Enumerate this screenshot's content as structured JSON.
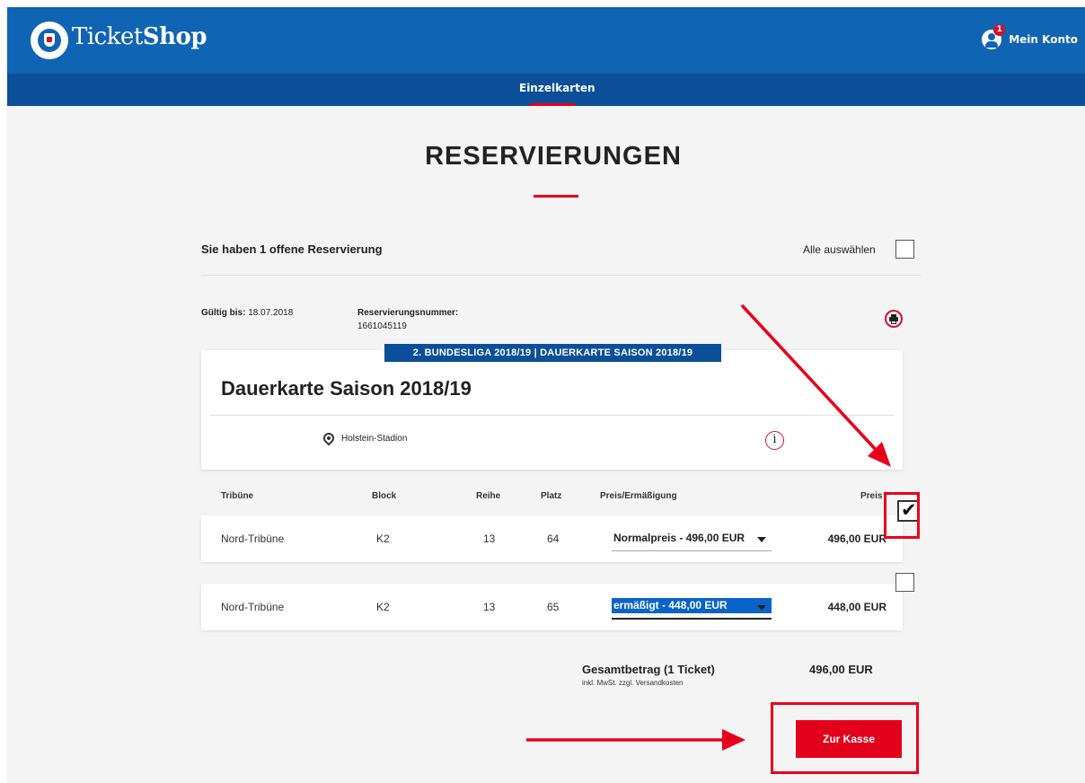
{
  "header": {
    "brand_light": "Ticket",
    "brand_bold": "Shop",
    "account_label": "Mein Konto",
    "account_badge": "1"
  },
  "subnav": {
    "tab": "Einzelkarten"
  },
  "page": {
    "title": "RESERVIERUNGEN",
    "reservation_count_text": "Sie haben 1 offene Reservierung",
    "select_all_label": "Alle auswählen"
  },
  "reservation": {
    "valid_label": "Gültig bis:",
    "valid_value": "18.07.2018",
    "number_label": "Reservierungsnummer:",
    "number_value": "1661045119"
  },
  "event": {
    "tag": "2. BUNDESLIGA 2018/19 | DAUERKARTE SAISON 2018/19",
    "title": "Dauerkarte Saison 2018/19",
    "venue": "Holstein-Stadion"
  },
  "table": {
    "headers": {
      "tribune": "Tribüne",
      "block": "Block",
      "row": "Reihe",
      "seat": "Platz",
      "price_option": "Preis/Ermäßigung",
      "price": "Preis"
    },
    "rows": [
      {
        "tribune": "Nord-Tribüne",
        "block": "K2",
        "row": "13",
        "seat": "64",
        "price_option": "Normalpreis - 496,00 EUR",
        "price": "496,00 EUR",
        "checked": true
      },
      {
        "tribune": "Nord-Tribüne",
        "block": "K2",
        "row": "13",
        "seat": "65",
        "price_option": "ermäßigt - 448,00 EUR",
        "price": "448,00 EUR",
        "checked": false
      }
    ]
  },
  "summary": {
    "total_label": "Gesamtbetrag (1 Ticket)",
    "total_sub": "inkl. MwSt. zzgl. Versandkosten",
    "total_value": "496,00 EUR",
    "checkout_label": "Zur Kasse"
  },
  "colors": {
    "brand_blue": "#0f64b4",
    "subnav_blue": "#0a4f97",
    "accent_red": "#e3001b"
  }
}
